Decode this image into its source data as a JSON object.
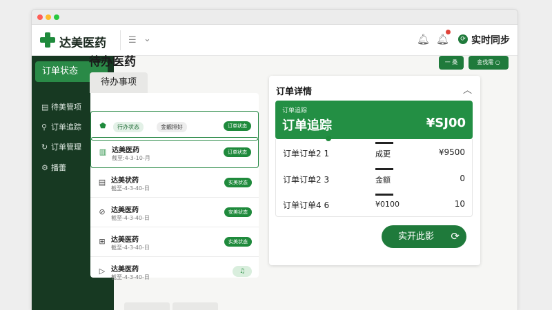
{
  "app": {
    "brand": "达美医药",
    "sync_label": "实时同步"
  },
  "sidebar": {
    "active": "订单状态",
    "items": [
      "待美管项",
      "订单追踪",
      "订单管理",
      "播蕾"
    ]
  },
  "main": {
    "title": "待办医药",
    "tab": "待办事项",
    "actions": [
      "一 桑",
      "金伐需"
    ]
  },
  "list": {
    "first_row": {
      "chip1": "行办状态",
      "chip2": "金靓排好",
      "badge": "订单状态"
    },
    "rows": [
      {
        "title": "达美医药",
        "sub": "截至:4-3-10-月",
        "badge": "订单状态"
      },
      {
        "title": "达美状药",
        "sub": "截至-4-3-40-日",
        "badge": "实美状态"
      },
      {
        "title": "达美医药",
        "sub": "截至-4-3-40-日",
        "badge": "安美状态"
      },
      {
        "title": "达美医药",
        "sub": "截至-4-3-40-日",
        "badge": "实美状态"
      },
      {
        "title": "达美医药",
        "sub": "截至-4-3-40-日",
        "badge": ""
      }
    ]
  },
  "detail": {
    "title": "订单详情",
    "hero_label": "订单追踪",
    "hero_title": "订单追踪",
    "hero_amount": "¥SJ00",
    "rows": [
      {
        "a": "订单订单2 1",
        "b": "成更",
        "c": "¥9500"
      },
      {
        "a": "订单订单2 3",
        "b": "金额",
        "c": "0"
      },
      {
        "a": "订单订单4 6",
        "b": "¥0100",
        "c": "10"
      }
    ],
    "button": "实开此影"
  },
  "colors": {
    "brand_green": "#1f8a3c",
    "sidebar_bg": "#173922",
    "accent_red": "#e0443a"
  }
}
